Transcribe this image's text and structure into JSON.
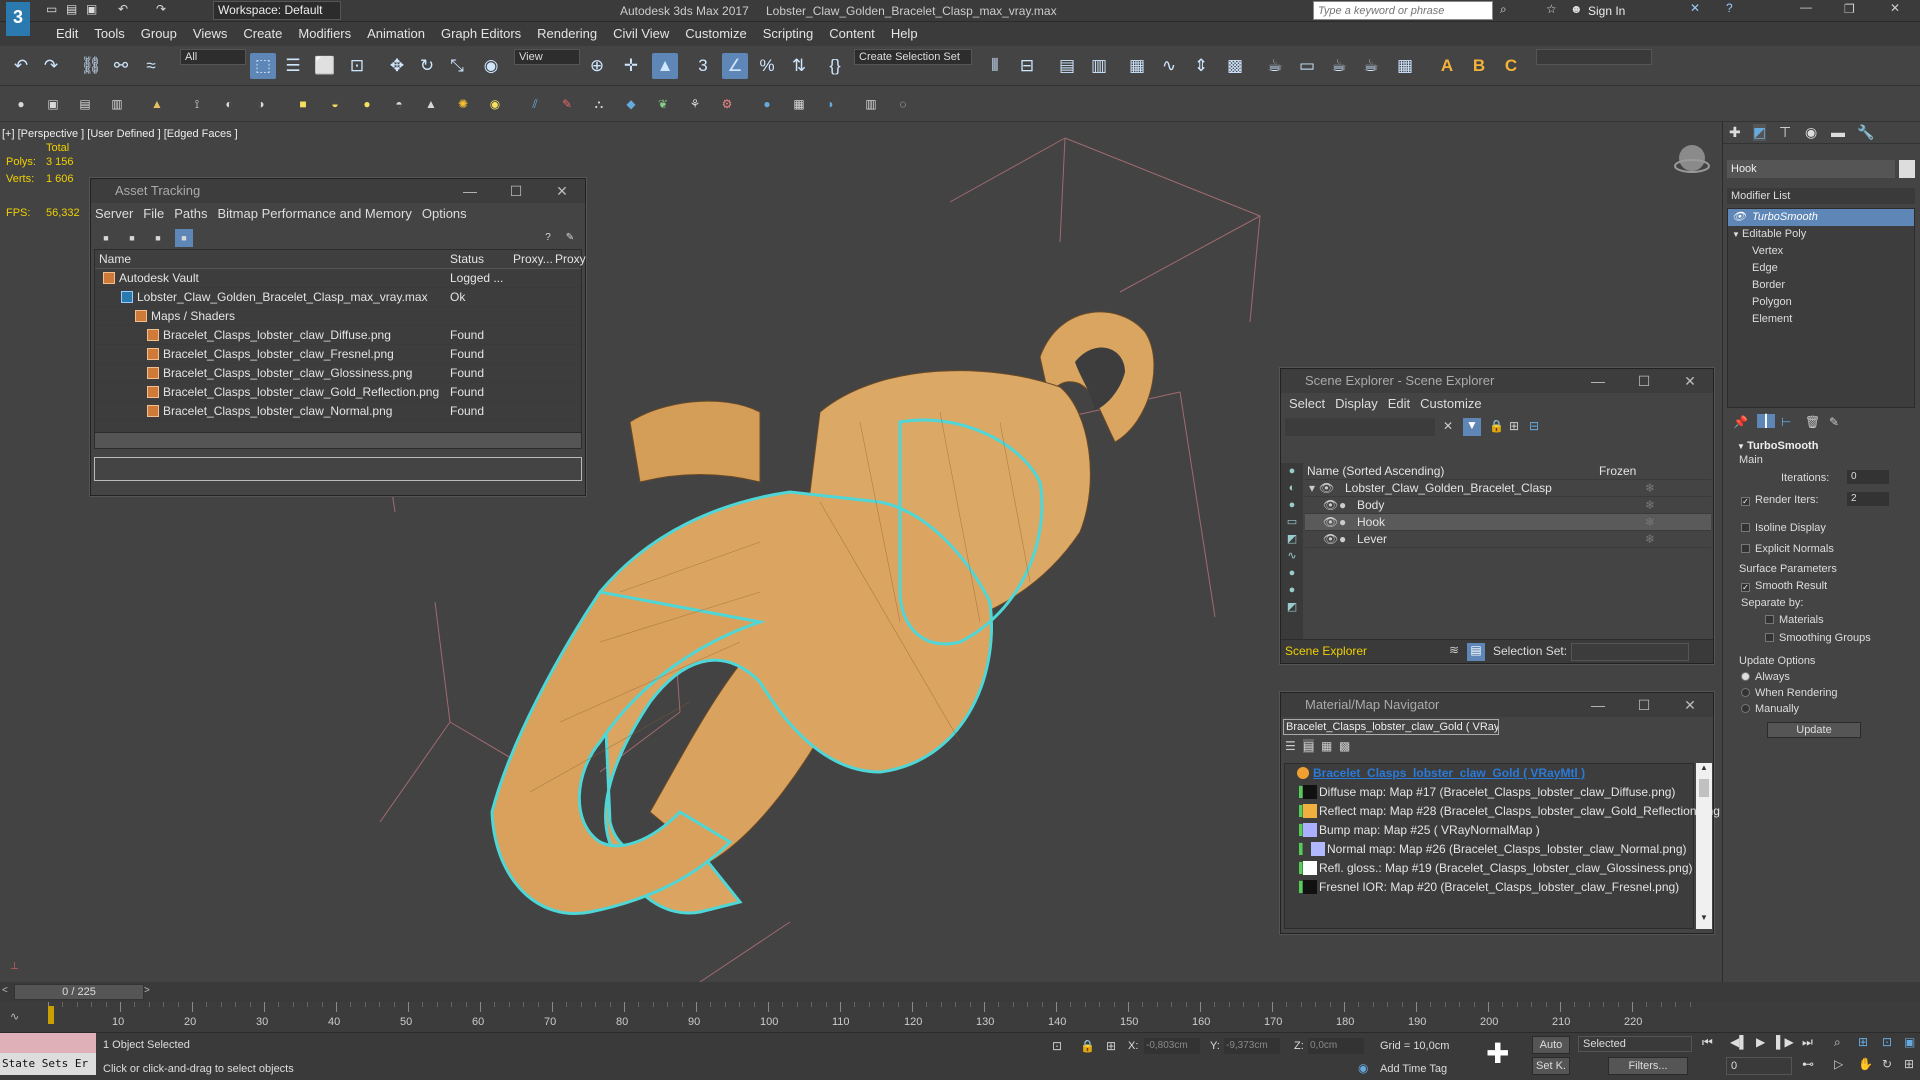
{
  "title_bar": {
    "workspace": "Workspace: Default",
    "app_title": "Autodesk 3ds Max 2017",
    "file_title": "Lobster_Claw_Golden_Bracelet_Clasp_max_vray.max",
    "search_placeholder": "Type a keyword or phrase",
    "sign_in": "Sign In"
  },
  "menu": [
    "Edit",
    "Tools",
    "Group",
    "Views",
    "Create",
    "Modifiers",
    "Animation",
    "Graph Editors",
    "Rendering",
    "Civil View",
    "Customize",
    "Scripting",
    "Content",
    "Help"
  ],
  "toolbar": {
    "selection_filter": "All",
    "ref_coord": "View",
    "named_selection": "Create Selection Set"
  },
  "viewport": {
    "label": "[+] [Perspective ] [User Defined ] [Edged Faces ]",
    "stats_total": "Total",
    "polys_label": "Polys:",
    "polys_value": "3 156",
    "verts_label": "Verts:",
    "verts_value": "1 606",
    "fps_label": "FPS:",
    "fps_value": "56,332"
  },
  "asset_tracking": {
    "title": "Asset Tracking",
    "menu": [
      "Server",
      "File",
      "Paths",
      "Bitmap Performance and Memory",
      "Options"
    ],
    "columns": [
      "Name",
      "Status",
      "Proxy...",
      "Proxy"
    ],
    "rows": [
      {
        "name": "Autodesk Vault",
        "status": "Logged ..."
      },
      {
        "name": "Lobster_Claw_Golden_Bracelet_Clasp_max_vray.max",
        "status": "Ok"
      },
      {
        "name": "Maps / Shaders",
        "status": ""
      },
      {
        "name": "Bracelet_Clasps_lobster_claw_Diffuse.png",
        "status": "Found"
      },
      {
        "name": "Bracelet_Clasps_lobster_claw_Fresnel.png",
        "status": "Found"
      },
      {
        "name": "Bracelet_Clasps_lobster_claw_Glossiness.png",
        "status": "Found"
      },
      {
        "name": "Bracelet_Clasps_lobster_claw_Gold_Reflection.png",
        "status": "Found"
      },
      {
        "name": "Bracelet_Clasps_lobster_claw_Normal.png",
        "status": "Found"
      }
    ]
  },
  "scene_explorer": {
    "title": "Scene Explorer - Scene Explorer",
    "menu": [
      "Select",
      "Display",
      "Edit",
      "Customize"
    ],
    "col_name": "Name (Sorted Ascending)",
    "col_frozen": "Frozen",
    "root": "Lobster_Claw_Golden_Bracelet_Clasp",
    "children": [
      "Body",
      "Hook",
      "Lever"
    ],
    "footer_name": "Scene Explorer",
    "selection_set_label": "Selection Set:"
  },
  "material_navigator": {
    "title": "Material/Map Navigator",
    "current": "Bracelet_Clasps_lobster_claw_Gold  ( VRayMtl",
    "root": "Bracelet_Clasps_lobster_claw_Gold  ( VRayMtl )",
    "items": [
      "Diffuse map: Map #17 (Bracelet_Clasps_lobster_claw_Diffuse.png)",
      "Reflect map: Map #28 (Bracelet_Clasps_lobster_claw_Gold_Reflection.png)",
      "Bump map: Map #25  ( VRayNormalMap )",
      "Normal map: Map #26 (Bracelet_Clasps_lobster_claw_Normal.png)",
      "Refl. gloss.: Map #19 (Bracelet_Clasps_lobster_claw_Glossiness.png)",
      "Fresnel IOR: Map #20 (Bracelet_Clasps_lobster_claw_Fresnel.png)"
    ]
  },
  "command_panel": {
    "object_name": "Hook",
    "modifier_list": "Modifier List",
    "stack": [
      "TurboSmooth",
      "Editable Poly",
      "Vertex",
      "Edge",
      "Border",
      "Polygon",
      "Element"
    ],
    "rollout_title": "TurboSmooth",
    "main_label": "Main",
    "iterations_label": "Iterations:",
    "iterations_value": "0",
    "render_iters_label": "Render Iters:",
    "render_iters_value": "2",
    "isoline": "Isoline Display",
    "explicit_normals": "Explicit Normals",
    "surface_params": "Surface Parameters",
    "smooth_result": "Smooth Result",
    "separate_by": "Separate by:",
    "materials": "Materials",
    "smoothing_groups": "Smoothing Groups",
    "update_options": "Update Options",
    "always": "Always",
    "when_rendering": "When Rendering",
    "manually": "Manually",
    "update_button": "Update"
  },
  "timeline": {
    "frame": "0 / 225",
    "ticks": [
      "0",
      "10",
      "20",
      "30",
      "40",
      "50",
      "60",
      "70",
      "80",
      "90",
      "100",
      "110",
      "120",
      "130",
      "140",
      "150",
      "160",
      "170",
      "180",
      "190",
      "200",
      "210",
      "220"
    ]
  },
  "status": {
    "state_sets": "State Sets Er",
    "selection": "1 Object Selected",
    "prompt": "Click or click-and-drag to select objects",
    "x_label": "X:",
    "x_value": "-0,803cm",
    "y_label": "Y:",
    "y_value": "-9,373cm",
    "z_label": "Z:",
    "z_value": "0,0cm",
    "grid": "Grid = 10,0cm",
    "add_time_tag": "Add Time Tag",
    "auto": "Auto",
    "selected": "Selected",
    "set_k": "Set K.",
    "filters": "Filters...",
    "frame_value": "0"
  }
}
